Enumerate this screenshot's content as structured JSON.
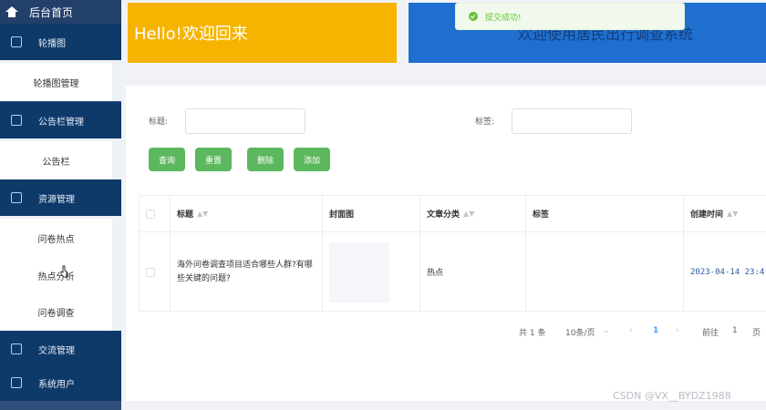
{
  "sidebar": {
    "home_label": "后台首页",
    "groups": [
      {
        "label": "轮播图",
        "icon": "shield-icon"
      },
      {
        "label": "公告栏管理",
        "icon": "edit-icon"
      },
      {
        "label": "资源管理",
        "icon": "resource-icon"
      },
      {
        "label": "交流管理",
        "icon": "chart-icon"
      },
      {
        "label": "系统用户",
        "icon": "diamond-icon"
      }
    ],
    "items": [
      {
        "label": "轮播图管理"
      },
      {
        "label": "公告栏"
      },
      {
        "label": "问卷热点"
      },
      {
        "label": "热点分析"
      },
      {
        "label": "问卷调查"
      }
    ]
  },
  "banners": {
    "welcome": "Hello!欢迎回来",
    "system": "欢迎使用居民出行调查系统"
  },
  "toast": {
    "message": "提交成功!",
    "color": "#67c23a"
  },
  "form": {
    "title_label": "标题:",
    "title_value": "",
    "tag_label": "标签:",
    "tag_value": ""
  },
  "buttons": {
    "query": "查询",
    "reset": "重置",
    "delete": "删除",
    "add": "添加"
  },
  "table": {
    "headers": {
      "title": "标题",
      "cover": "封面图",
      "category": "文章分类",
      "tags": "标签",
      "created": "创建时间"
    },
    "rows": [
      {
        "title": "海外问卷调查项目适合哪些人群?有哪些关键的问题?",
        "category": "热点",
        "tags": "",
        "created": "2023-04-14 23:4"
      }
    ]
  },
  "pagination": {
    "total": "共 1 条",
    "page_size": "10条/页",
    "prev": "‹",
    "current_page": "1",
    "next": "›",
    "goto_label": "前往",
    "goto_value": "1",
    "page_suffix": "页"
  },
  "watermark": "CSDN @VX__BYDZ1988",
  "colors": {
    "sidebar": "#0e3a6a",
    "banner_yellow": "#f6b400",
    "banner_blue": "#1f6fd0",
    "button_green": "#5cb85c"
  }
}
